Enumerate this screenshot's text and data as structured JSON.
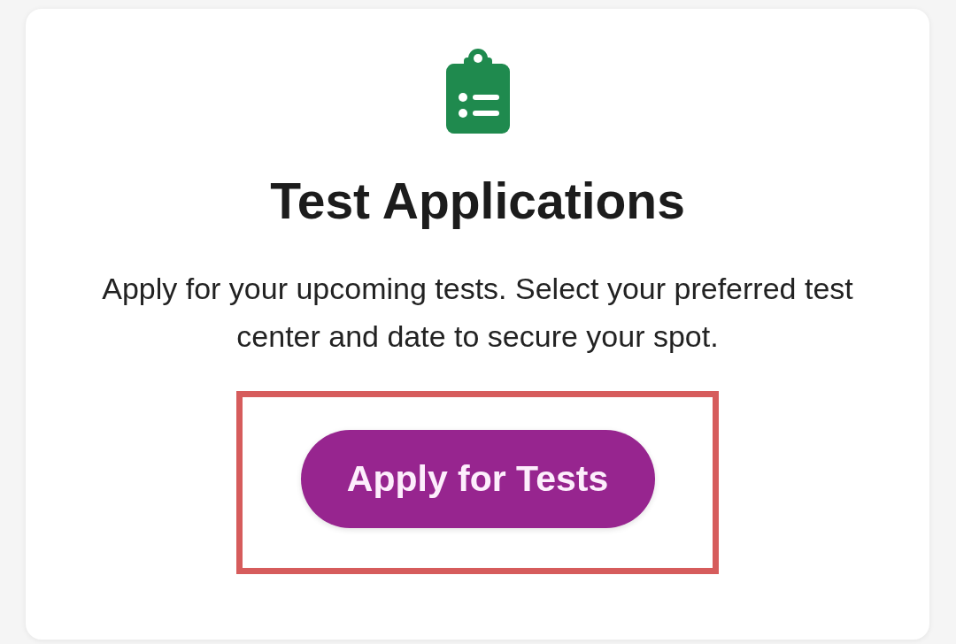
{
  "card": {
    "title": "Test Applications",
    "description": "Apply for your upcoming tests. Select your preferred test center and date to secure your spot.",
    "button": {
      "label": "Apply for Tests",
      "highlighted": true
    }
  }
}
